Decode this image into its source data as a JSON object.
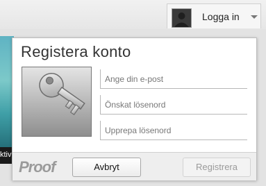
{
  "header": {
    "login_label": "Logga in"
  },
  "background": {
    "partial_text": "ktiv"
  },
  "dialog": {
    "title": "Registera konto",
    "fields": [
      {
        "placeholder": "Ange din e-post",
        "value": ""
      },
      {
        "placeholder": "Önskat lösenord",
        "value": ""
      },
      {
        "placeholder": "Upprepa lösenord",
        "value": ""
      }
    ],
    "logo_text": "Proof",
    "cancel_label": "Avbryt",
    "register_label": "Registrera",
    "register_enabled": false
  },
  "icons": {
    "avatar": "user-silhouette-icon",
    "caret": "chevron-down-icon",
    "key": "key-icon"
  },
  "colors": {
    "topbar": "#e6e6e6",
    "panel_bg": "#ffffff",
    "footer_bg": "#eeeeee",
    "disabled_text": "#9a9a9a"
  }
}
